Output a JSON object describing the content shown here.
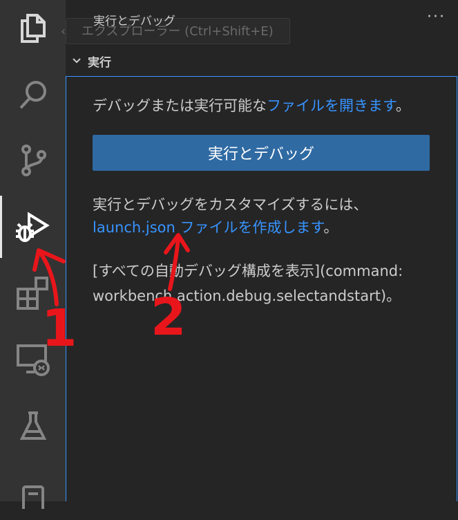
{
  "sidebar": {
    "title": "実行とデバッグ",
    "ghost_tooltip": "エクスプローラー (Ctrl+Shift+E)",
    "more": "···",
    "section_title": "実行"
  },
  "content": {
    "intro_text": "デバッグまたは実行可能な",
    "open_file_link": "ファイルを開きます",
    "intro_end": "。",
    "run_button": "実行とデバッグ",
    "customize_text": "実行とデバッグをカスタマイズするには、",
    "launch_link": "launch.json ファイルを作成します",
    "launch_end": "。",
    "show_all_line1": "[すべての自動デバッグ構成を表示](command:",
    "show_all_line2": "workbench.action.debug.selectandstart)。"
  },
  "annotations": {
    "one": "1",
    "two": "2"
  },
  "colors": {
    "link": "#3794ff",
    "button": "#2f6aa3",
    "annotation": "#e8161b"
  }
}
